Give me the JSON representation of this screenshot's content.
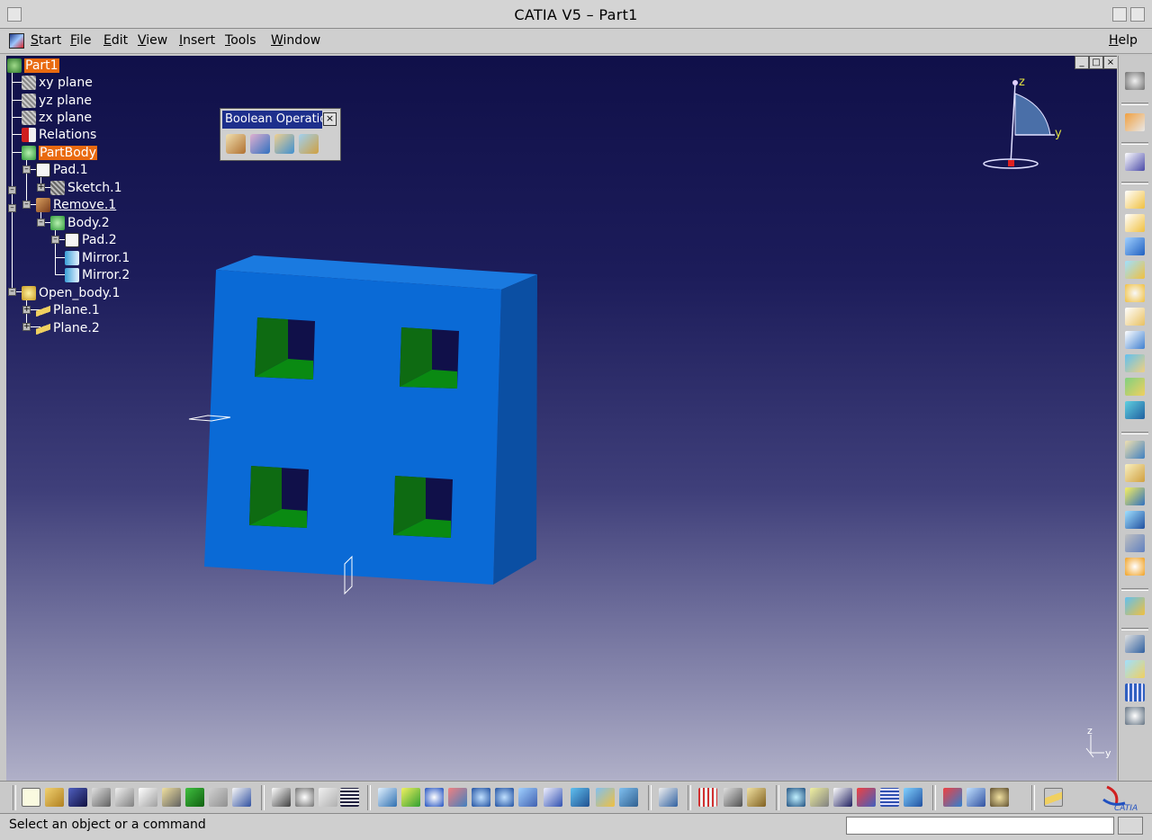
{
  "window": {
    "title": "CATIA V5 – Part1"
  },
  "menu": {
    "items": [
      {
        "label": "Start",
        "name": "menu-start"
      },
      {
        "label": "File",
        "name": "menu-file"
      },
      {
        "label": "Edit",
        "name": "menu-edit"
      },
      {
        "label": "View",
        "name": "menu-view"
      },
      {
        "label": "Insert",
        "name": "menu-insert"
      },
      {
        "label": "Tools",
        "name": "menu-tools"
      },
      {
        "label": "Window",
        "name": "menu-window"
      }
    ],
    "help": "Help"
  },
  "tree": {
    "nodes": [
      {
        "label": "Part1",
        "highlight": true,
        "icon": "part-icon"
      },
      {
        "label": "xy plane",
        "icon": "plane-icon"
      },
      {
        "label": "yz plane",
        "icon": "plane-icon"
      },
      {
        "label": "zx plane",
        "icon": "plane-icon"
      },
      {
        "label": "Relations",
        "icon": "relations-icon"
      },
      {
        "label": "PartBody",
        "highlight": true,
        "icon": "body-icon"
      },
      {
        "label": "Pad.1",
        "icon": "pad-icon"
      },
      {
        "label": "Sketch.1",
        "icon": "sketch-icon"
      },
      {
        "label": "Remove.1",
        "underline": true,
        "icon": "remove-icon"
      },
      {
        "label": "Body.2",
        "icon": "body-icon"
      },
      {
        "label": "Pad.2",
        "icon": "pad-icon"
      },
      {
        "label": "Mirror.1",
        "icon": "mirror-icon"
      },
      {
        "label": "Mirror.2",
        "icon": "mirror-icon"
      },
      {
        "label": "Open_body.1",
        "icon": "open-body-icon"
      },
      {
        "label": "Plane.1",
        "icon": "plane-feature-icon"
      },
      {
        "label": "Plane.2",
        "icon": "plane-feature-icon"
      }
    ]
  },
  "boolean_toolbar": {
    "title": "Boolean Operations",
    "icons": [
      "assemble-icon",
      "add-icon",
      "remove-icon",
      "intersect-icon"
    ]
  },
  "compass": {
    "z": "z",
    "y": "y"
  },
  "mini_axes": {
    "z": "z",
    "y": "y"
  },
  "status": {
    "message": "Select an object or a command",
    "command_value": ""
  },
  "brand": "CATIA",
  "colors": {
    "highlight": "#e96a10",
    "part_face": "#0a6ad6",
    "part_side": "#0b4fa3",
    "pocket_wall": "#0e6b12",
    "pocket_floor": "#0a8a12",
    "title_bar_active": "#1d2f8c"
  }
}
